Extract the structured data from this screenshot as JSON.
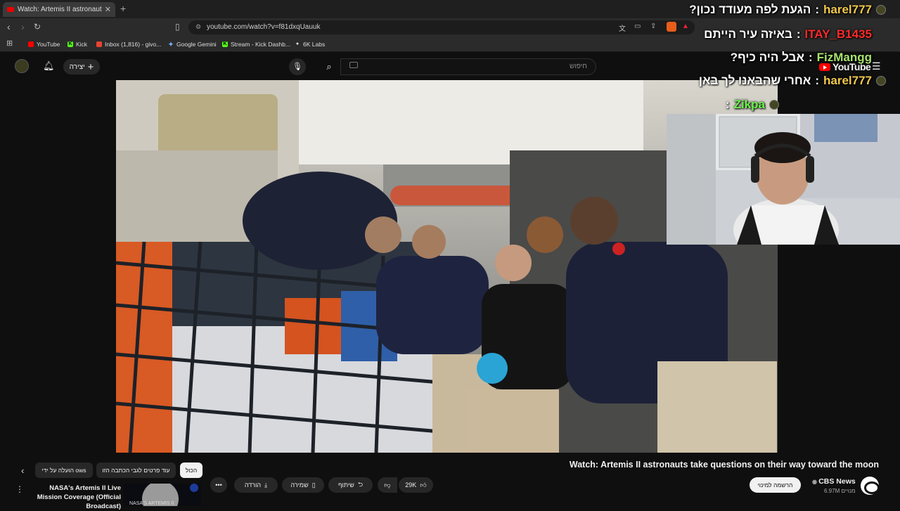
{
  "browser": {
    "tab_title": "Watch: Artemis II astronauts take",
    "url": "youtube.com/watch?v=f81dxqUauuk",
    "bookmarks": [
      "YouTube",
      "Kick",
      "Inbox (1,816) - givo...",
      "Google Gemini",
      "Stream - Kick Dashb...",
      "6K Labs"
    ]
  },
  "yt_header": {
    "create_label": "יצירה",
    "search_placeholder": "חיפוש",
    "logo_text": "YouTube"
  },
  "chat": [
    {
      "user": "harel777",
      "message": "?הגעת לפה מעודד נכון"
    },
    {
      "user": "ITAY_B1435",
      "message": "באיזה עיר הייתם"
    },
    {
      "user": "FizMangg",
      "message": "?אבל היה כיף"
    },
    {
      "user": "harel777",
      "message": "אחרי שהבאנו לך באן"
    },
    {
      "user": "Zikpa",
      "message": ""
    }
  ],
  "video": {
    "title": "Watch: Artemis II astronauts take questions on their way toward the moon",
    "channel": "CBS News",
    "subscribers": "6.97M מנויים",
    "subscribe_label": "הרשמה למינוי",
    "like_count": "29K",
    "share_label": "שיתוף",
    "save_label": "שמירה",
    "download_label": "הורדה",
    "more_label": "•••"
  },
  "chips": [
    "הכול",
    "עוד פרטים לגבי הכתבה הזו",
    "הועלה על ידי ows"
  ],
  "recommendation": {
    "title": "NASA's Artemis II Live Mission Coverage (Official Broadcast)",
    "thumb_text": "NASA'S ARTEMIS II"
  },
  "colors": {
    "youtube_red": "#ff0000",
    "background": "#0f0f0f",
    "chat_user": "#f2c94c"
  }
}
